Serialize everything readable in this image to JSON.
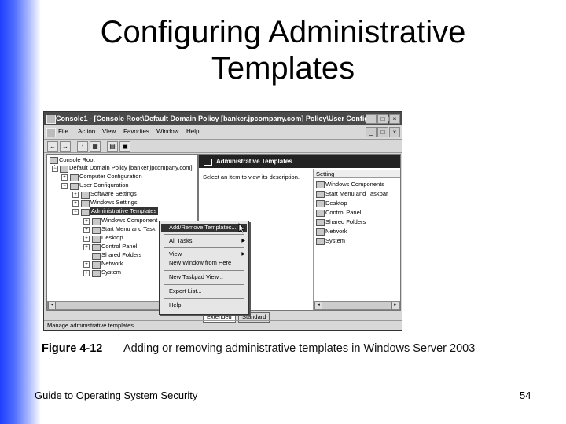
{
  "slide": {
    "title_line1": "Configuring Administrative",
    "title_line2": "Templates",
    "footer_left": "Guide to Operating System Security",
    "page_number": "54"
  },
  "caption": {
    "figure": "Figure 4-12",
    "text": "Adding or removing administrative templates in Windows Server 2003"
  },
  "window": {
    "title": "Console1 - [Console Root\\Default Domain Policy [banker.jpcompany.com] Policy\\User Configuration...",
    "menu": [
      "File",
      "Action",
      "View",
      "Favorites",
      "Window",
      "Help"
    ],
    "title_buttons": [
      "_",
      "□",
      "×"
    ],
    "mdi_buttons": [
      "_",
      "□",
      "×"
    ]
  },
  "toolbar": {
    "buttons": [
      "←",
      "→",
      "↑",
      "▦",
      "▤",
      "▣"
    ]
  },
  "tree": {
    "root": "Console Root",
    "policy": "Default Domain Policy [banker.jpcompany.com]",
    "computer_configuration": "Computer Configuration",
    "user_configuration": "User Configuration",
    "software_settings": "Software Settings",
    "windows_settings": "Windows Settings",
    "administrative_templates": "Administrative Templates",
    "children": [
      "Windows Component",
      "Start Menu and Task",
      "Desktop",
      "Control Panel",
      "Shared Folders",
      "Network",
      "System"
    ]
  },
  "right_pane": {
    "header": "Administrative Templates",
    "description": "Select an item to view its description.",
    "column": "Setting",
    "items": [
      "Windows Components",
      "Start Menu and Taskbar",
      "Desktop",
      "Control Panel",
      "Shared Folders",
      "Network",
      "System"
    ]
  },
  "context_menu": {
    "add_remove": "Add/Remove Templates...",
    "all_tasks": "All Tasks",
    "view": "View",
    "new_window": "New Window from Here",
    "new_taskpad": "New Taskpad View...",
    "export": "Export List...",
    "help": "Help"
  },
  "tabs": [
    "Extended",
    "Standard"
  ],
  "status": "Manage administrative templates"
}
